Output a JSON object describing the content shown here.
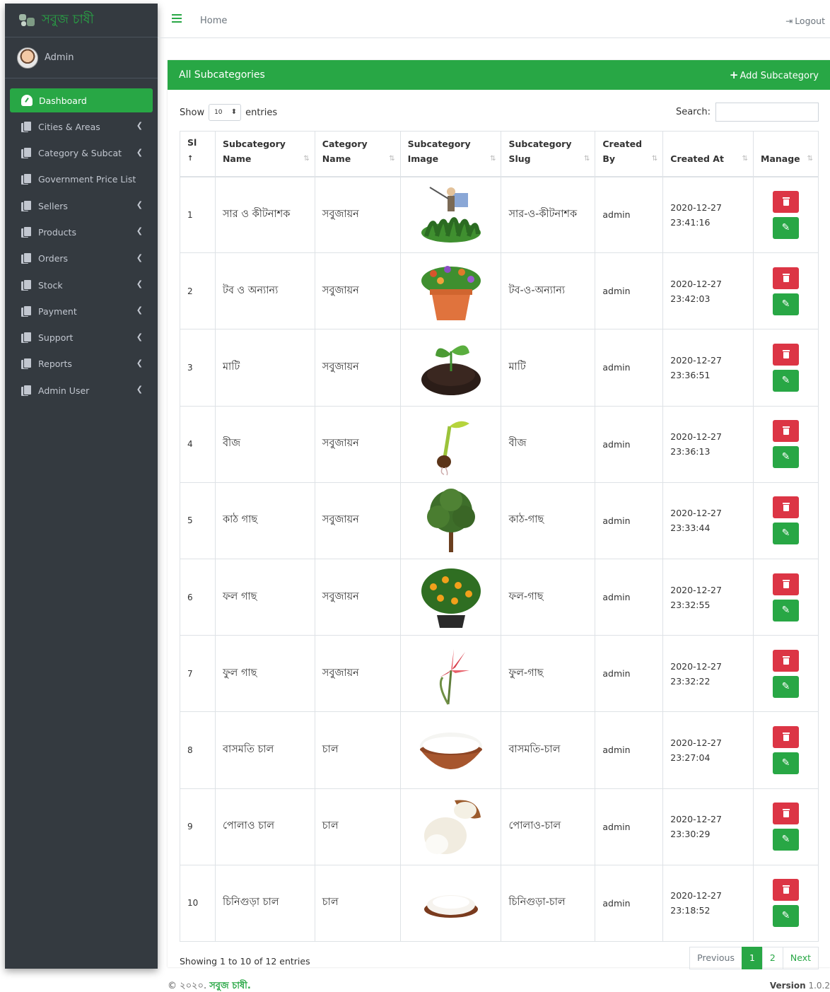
{
  "brand": {
    "name": "সবুজ চাষী"
  },
  "user": {
    "name": "Admin"
  },
  "sidebar": {
    "items": [
      {
        "label": "Dashboard",
        "active": true,
        "chevron": false
      },
      {
        "label": "Cities & Areas",
        "chevron": true
      },
      {
        "label": "Category & Subcat",
        "chevron": true
      },
      {
        "label": "Government Price List",
        "chevron": false
      },
      {
        "label": "Sellers",
        "chevron": true
      },
      {
        "label": "Products",
        "chevron": true
      },
      {
        "label": "Orders",
        "chevron": true
      },
      {
        "label": "Stock",
        "chevron": true
      },
      {
        "label": "Payment",
        "chevron": true
      },
      {
        "label": "Support",
        "chevron": true
      },
      {
        "label": "Reports",
        "chevron": true
      },
      {
        "label": "Admin User",
        "chevron": true
      }
    ]
  },
  "topbar": {
    "home": "Home",
    "logout": "Logout"
  },
  "card": {
    "title": "All Subcategories",
    "add_label": "Add Subcategory"
  },
  "controls": {
    "show": "Show",
    "page_size": "10",
    "entries": "entries",
    "search_label": "Search:"
  },
  "table": {
    "headers": [
      {
        "line1": "Sl",
        "line2": ""
      },
      {
        "line1": "Subcategory",
        "line2": "Name"
      },
      {
        "line1": "Category",
        "line2": "Name"
      },
      {
        "line1": "Subcategory",
        "line2": "Image"
      },
      {
        "line1": "Subcategory",
        "line2": "Slug"
      },
      {
        "line1": "Created",
        "line2": "By"
      },
      {
        "line1": "",
        "line2": "Created At"
      },
      {
        "line1": "",
        "line2": "Manage"
      }
    ],
    "rows": [
      {
        "sl": "1",
        "name": "সার ও কীটনাশক",
        "category": "সবুজায়ন",
        "image": "farmer-spraying-plants",
        "slug": "সার-ও-কীটনাশক",
        "by": "admin",
        "date": "2020-12-27",
        "time": "23:41:16"
      },
      {
        "sl": "2",
        "name": "টব ও অন্যান্য",
        "category": "সবুজায়ন",
        "image": "flower-pot",
        "slug": "টব-ও-অন্যান্য",
        "by": "admin",
        "date": "2020-12-27",
        "time": "23:42:03"
      },
      {
        "sl": "3",
        "name": "মাটি",
        "category": "সবুজায়ন",
        "image": "soil-with-sprout",
        "slug": "মাটি",
        "by": "admin",
        "date": "2020-12-27",
        "time": "23:36:51"
      },
      {
        "sl": "4",
        "name": "বীজ",
        "category": "সবুজায়ন",
        "image": "germinating-seed",
        "slug": "বীজ",
        "by": "admin",
        "date": "2020-12-27",
        "time": "23:36:13"
      },
      {
        "sl": "5",
        "name": "কাঠ গাছ",
        "category": "সবুজায়ন",
        "image": "tree",
        "slug": "কাঠ-গাছ",
        "by": "admin",
        "date": "2020-12-27",
        "time": "23:33:44"
      },
      {
        "sl": "6",
        "name": "ফল গাছ",
        "category": "সবুজায়ন",
        "image": "orange-fruit-plant",
        "slug": "ফল-গাছ",
        "by": "admin",
        "date": "2020-12-27",
        "time": "23:32:55"
      },
      {
        "sl": "7",
        "name": "ফুল গাছ",
        "category": "সবুজায়ন",
        "image": "red-flower",
        "slug": "ফুল-গাছ",
        "by": "admin",
        "date": "2020-12-27",
        "time": "23:32:22"
      },
      {
        "sl": "8",
        "name": "বাসমতি চাল",
        "category": "চাল",
        "image": "rice-bowl",
        "slug": "বাসমতি-চাল",
        "by": "admin",
        "date": "2020-12-27",
        "time": "23:27:04"
      },
      {
        "sl": "9",
        "name": "পোলাও চাল",
        "category": "চাল",
        "image": "rice-spilling-bowl",
        "slug": "পোলাও-চাল",
        "by": "admin",
        "date": "2020-12-27",
        "time": "23:30:29"
      },
      {
        "sl": "10",
        "name": "চিনিগুড়া চাল",
        "category": "চাল",
        "image": "rice-plate",
        "slug": "চিনিগুড়া-চাল",
        "by": "admin",
        "date": "2020-12-27",
        "time": "23:18:52"
      }
    ]
  },
  "pagination": {
    "info": "Showing 1 to 10 of 12 entries",
    "previous": "Previous",
    "pages": [
      "1",
      "2"
    ],
    "next": "Next"
  },
  "footer": {
    "copyright_prefix": "© ২০২০.",
    "brand": "সবুজ চাষী.",
    "version_label": "Version",
    "version_value": "1.0.2"
  },
  "colors": {
    "accent": "#28a745",
    "danger": "#dc3545",
    "sidebar": "#343a40"
  }
}
